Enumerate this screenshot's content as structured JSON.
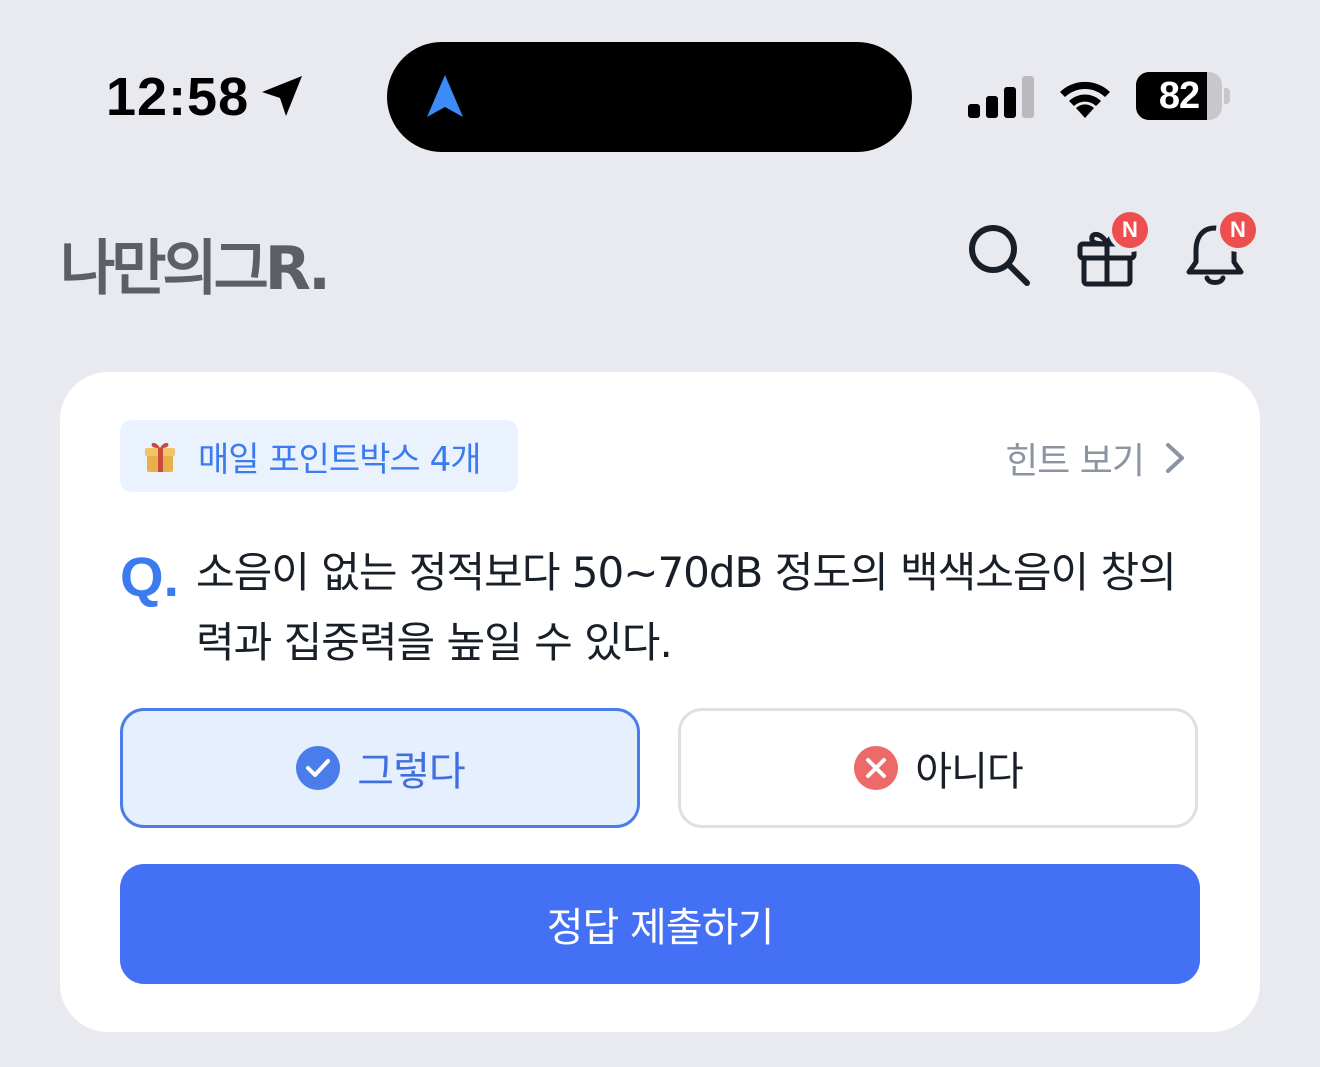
{
  "status_bar": {
    "time": "12:58",
    "battery_level": "82",
    "battery_fraction": 0.82,
    "icons": [
      "location-arrow-icon",
      "navigation-arrow-icon",
      "cellular-signal-icon",
      "wifi-icon",
      "battery-icon"
    ]
  },
  "header": {
    "logo": "나만의그R.",
    "icons": [
      "search-icon",
      "gift-icon",
      "bell-icon"
    ],
    "gift_badge": "N",
    "bell_badge": "N",
    "badge_color": "#EE4E4E"
  },
  "quiz": {
    "point_box_label": "매일 포인트박스 4개",
    "point_box_icon": "gift-box-emoji-icon",
    "hint_label": "힌트 보기",
    "question_prefix": "Q.",
    "question_text": "소음이 없는 정적보다 50~70dB 정도의 백색소음이 창의력과 집중력을 높일 수 있다.",
    "options": [
      {
        "label": "그렇다",
        "icon": "check-circle-icon",
        "selected": true
      },
      {
        "label": "아니다",
        "icon": "x-circle-icon",
        "selected": false
      }
    ],
    "submit_label": "정답 제출하기"
  },
  "colors": {
    "accent": "#4470F5",
    "question_blue": "#3A7BF0",
    "background": "#E9EAEF"
  }
}
